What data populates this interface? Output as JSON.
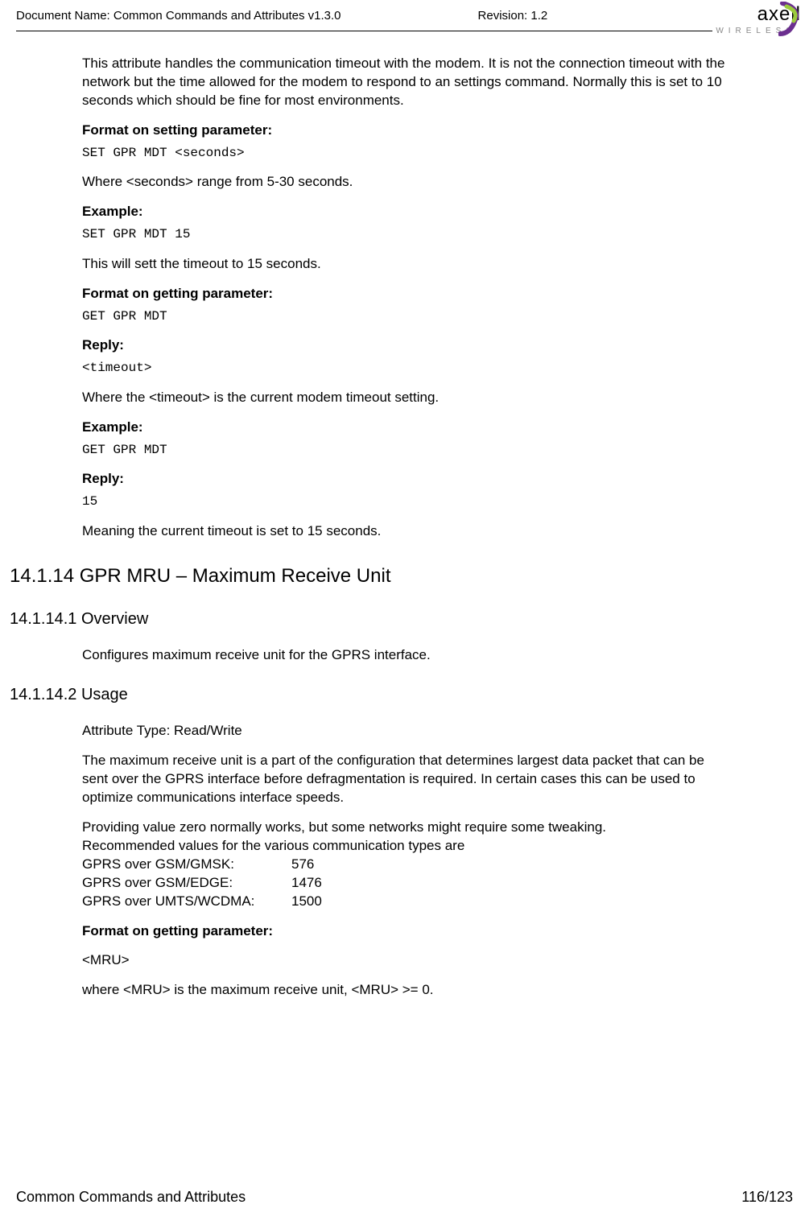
{
  "header": {
    "doc_name": "Document Name: Common Commands and Attributes v1.3.0",
    "revision": "Revision: 1.2",
    "logo_text": "axell",
    "logo_sub": "WIRELESS"
  },
  "body": {
    "p1": "This attribute handles the communication timeout with the modem. It is not the connection timeout with the network but the time allowed for the modem to respond to an settings command. Normally this is set to 10 seconds which should be fine for most environments.",
    "h_fmt_set": "Format on setting parameter:",
    "code_set": "SET GPR MDT <seconds>",
    "p2": "Where <seconds> range from 5-30 seconds.",
    "h_ex1": "Example:",
    "code_ex1": "SET GPR MDT 15",
    "p3": "This will sett the timeout to 15 seconds.",
    "h_fmt_get": "Format on getting parameter:",
    "code_get": "GET GPR MDT",
    "h_reply1": "Reply:",
    "code_reply1": "<timeout>",
    "p4": "Where the <timeout> is the current modem timeout setting.",
    "h_ex2": "Example:",
    "code_ex2": "GET GPR MDT",
    "h_reply2": "Reply:",
    "code_reply2": "15",
    "p5": "Meaning the current timeout is set to 15 seconds.",
    "sec_14_1_14": "14.1.14 GPR MRU – Maximum Receive Unit",
    "sub_overview": "14.1.14.1 Overview",
    "p6": "Configures maximum receive unit for the GPRS interface.",
    "sub_usage": "14.1.14.2 Usage",
    "p7": "Attribute Type: Read/Write",
    "p8": "The maximum receive unit is a part of the configuration that determines largest data packet that can be sent over the GPRS interface before defragmentation is required. In certain cases this can be used to optimize communications interface speeds.",
    "p9a": "Providing value zero normally works, but some networks might require some tweaking.",
    "p9b": "Recommended values for the various communication types are",
    "rec1_l": "GPRS over GSM/GMSK:",
    "rec1_v": "576",
    "rec2_l": "GPRS over GSM/EDGE:",
    "rec2_v": "1476",
    "rec3_l": "GPRS over UMTS/WCDMA:",
    "rec3_v": "1500",
    "h_fmt_get2": "Format on getting parameter:",
    "p10": "<MRU>",
    "p11": "where <MRU> is the maximum receive unit, <MRU> >= 0."
  },
  "footer": {
    "left": "Common Commands and Attributes",
    "right": "116/123"
  }
}
